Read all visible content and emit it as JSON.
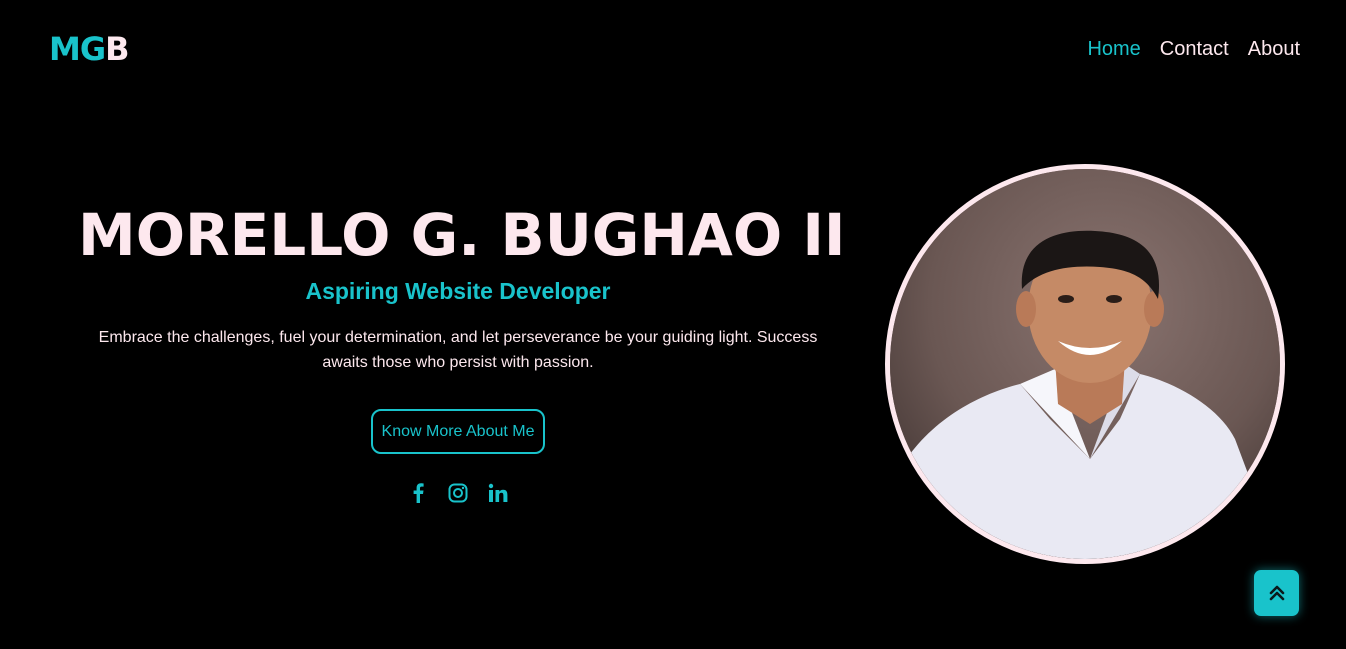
{
  "header": {
    "logo": {
      "m": "M",
      "g": "G",
      "b": "B"
    },
    "nav": [
      {
        "label": "Home",
        "active": true
      },
      {
        "label": "Contact",
        "active": false
      },
      {
        "label": "About",
        "active": false
      }
    ]
  },
  "hero": {
    "name": "MORELLO G. BUGHAO II",
    "role": "Aspiring Website Developer",
    "text": "Embrace the challenges, fuel your determination, and let perseverance be your guiding light. Success awaits those who persist with passion.",
    "cta_label": "Know More About Me",
    "socials": [
      {
        "icon": "facebook-icon"
      },
      {
        "icon": "instagram-icon"
      },
      {
        "icon": "linkedin-icon"
      }
    ]
  },
  "portrait": {
    "alt": "profile-photo"
  },
  "back_to_top": {
    "icon": "double-chevron-up-icon"
  },
  "colors": {
    "accent": "#19c3cb",
    "text": "#fde8ee",
    "background": "#000000"
  }
}
